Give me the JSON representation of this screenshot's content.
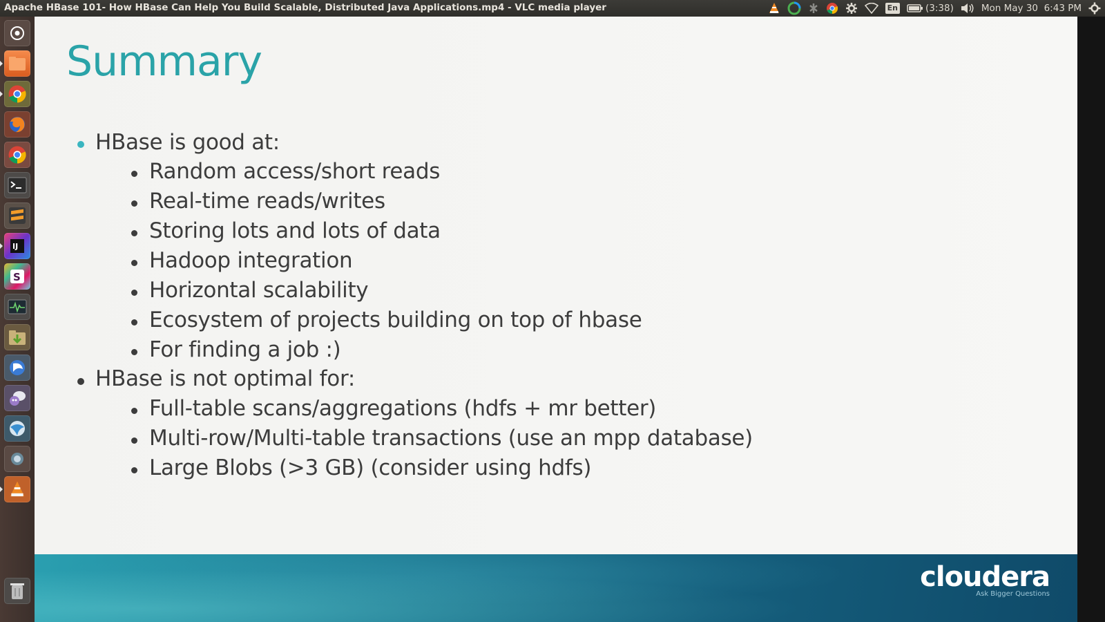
{
  "window": {
    "title": "Apache HBase 101- How HBase Can Help You Build Scalable, Distributed Java Applications.mp4 - VLC media player"
  },
  "top_panel": {
    "indicators": [
      "vlc-icon",
      "sync-icon",
      "bluetooth-icon",
      "chrome-icon",
      "settings-icon",
      "wifi-icon",
      "keyboard-layout-icon",
      "battery-icon",
      "volume-icon",
      "system-menu-icon"
    ],
    "keyboard_layout": "En",
    "battery_time": "(3:38)",
    "clock": "Mon May 30  6:43 PM"
  },
  "launcher": {
    "items": [
      "dash-home-icon",
      "files-icon",
      "chrome-icon",
      "firefox-icon",
      "chromium-icon",
      "terminal-icon",
      "sublime-text-icon",
      "intellij-icon",
      "slack-icon",
      "system-monitor-icon",
      "downloads-icon",
      "eclipse-icon",
      "pidgin-icon",
      "web-browser-icon",
      "app-icon",
      "vlc-icon",
      "trash-icon"
    ]
  },
  "slide": {
    "title": "Summary",
    "sections": [
      {
        "heading": "HBase is good at:",
        "items": [
          "Random access/short reads",
          "Real-time reads/writes",
          "Storing lots and lots of data",
          "Hadoop integration",
          "Horizontal scalability",
          "Ecosystem of projects building on top of hbase",
          "For finding a job :)"
        ]
      },
      {
        "heading": "HBase is not optimal for:",
        "items": [
          "Full-table scans/aggregations (hdfs + mr better)",
          "Multi-row/Multi-table transactions (use an mpp database)",
          "Large Blobs (>3 GB) (consider using hdfs)"
        ]
      }
    ],
    "logo_word": "cloudera",
    "logo_tagline": "Ask Bigger Questions"
  },
  "colors": {
    "title": "#2aa3a8",
    "bullet_first": "#3ab5c0",
    "text": "#3c3c3c"
  }
}
